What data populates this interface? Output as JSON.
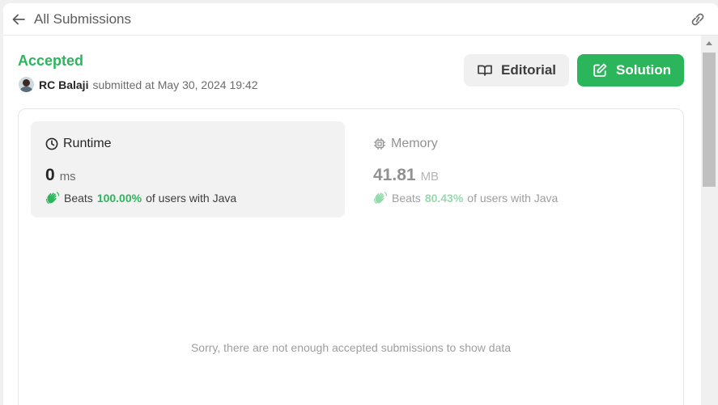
{
  "topbar": {
    "back_icon": "arrow-left-icon",
    "title": "All Submissions",
    "link_icon": "link-icon"
  },
  "submission": {
    "status": "Accepted",
    "status_color": "#2db55d",
    "user_name": "RC Balaji",
    "submitted_text": "submitted at",
    "timestamp": "May 30, 2024 19:42"
  },
  "actions": {
    "editorial_label": "Editorial",
    "editorial_icon": "book-open-icon",
    "solution_label": "Solution",
    "solution_icon": "edit-icon",
    "solution_color": "#2cb65b"
  },
  "runtime": {
    "title": "Runtime",
    "icon": "clock-icon",
    "value": "0",
    "unit": "ms",
    "beats_label": "Beats",
    "beats_pct": "100.00%",
    "beats_suffix": "of users with Java"
  },
  "memory": {
    "title": "Memory",
    "icon": "chip-icon",
    "value": "41.81",
    "unit": "MB",
    "beats_label": "Beats",
    "beats_pct": "80.43%",
    "beats_suffix": "of users with Java"
  },
  "chart": {
    "empty_message": "Sorry, there are not enough accepted submissions to show data"
  }
}
